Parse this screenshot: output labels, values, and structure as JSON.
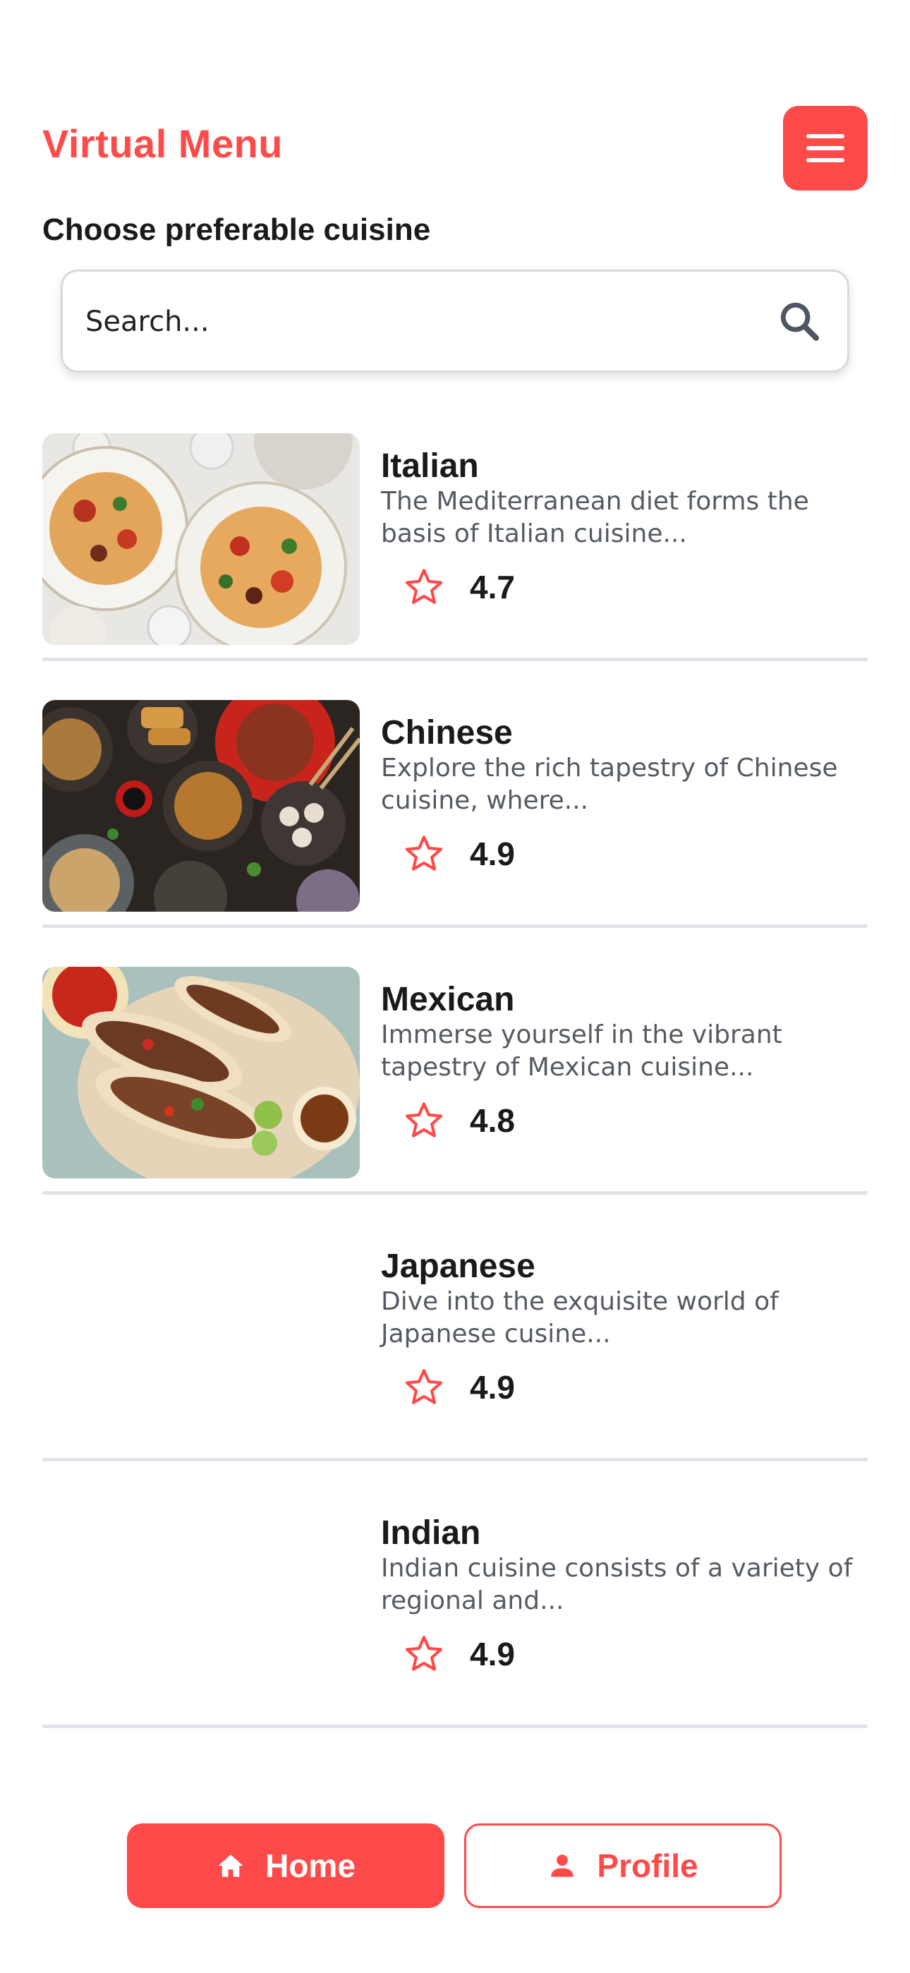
{
  "header": {
    "title": "Virtual Menu",
    "menu_icon": "hamburger-menu-icon"
  },
  "section": {
    "heading": "Choose preferable cuisine"
  },
  "search": {
    "placeholder": "Search...",
    "value": "",
    "icon": "search-icon"
  },
  "cuisines": [
    {
      "name": "Italian",
      "description": "The Mediterranean diet forms the basis of Italian cuisine...",
      "rating": "4.7",
      "image": "italian-pasta-photo"
    },
    {
      "name": "Chinese",
      "description": "Explore the rich tapestry of Chinese cuisine, where...",
      "rating": "4.9",
      "image": "chinese-dishes-photo"
    },
    {
      "name": "Mexican",
      "description": "Immerse yourself in the vibrant tapestry of Mexican cuisine...",
      "rating": "4.8",
      "image": "mexican-tacos-photo"
    },
    {
      "name": "Japanese",
      "description": "Dive into the exquisite world of Japanese cusine...",
      "rating": "4.9",
      "image": ""
    },
    {
      "name": "Indian",
      "description": "Indian cuisine consists of a variety of regional and...",
      "rating": "4.9",
      "image": ""
    }
  ],
  "bottom_nav": {
    "home_label": "Home",
    "home_icon": "home-icon",
    "profile_label": "Profile",
    "profile_icon": "person-icon"
  },
  "colors": {
    "accent": "#ff4a4a",
    "divider": "#e2e3e8",
    "text_primary": "#1a1a1a",
    "text_secondary": "#555a63"
  }
}
